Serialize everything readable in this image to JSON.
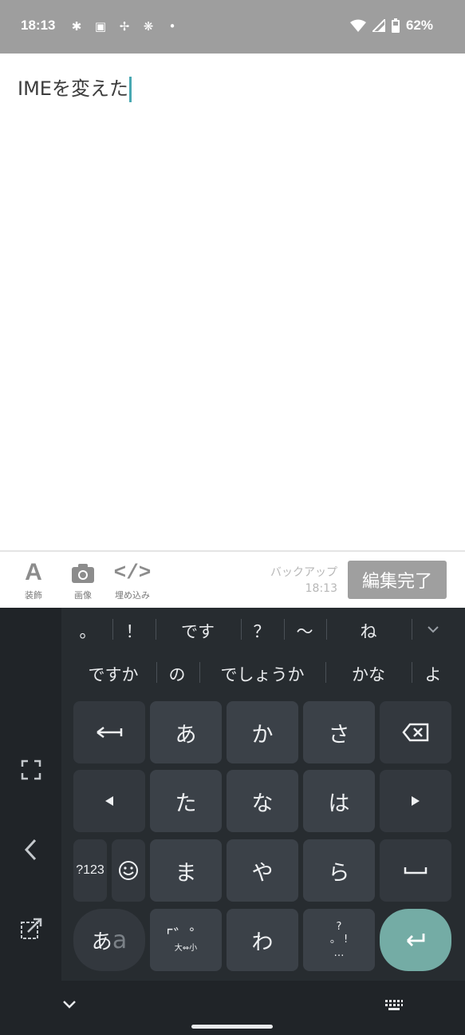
{
  "status_bar": {
    "time": "18:13",
    "battery": "62%",
    "icons_left": [
      "slack-icon",
      "book-icon",
      "pinwheel-icon",
      "chat-icon",
      "dot-icon"
    ],
    "icons_right": [
      "wifi-icon",
      "signal-icon",
      "battery-icon"
    ]
  },
  "editor": {
    "text": "IMEを変えた"
  },
  "toolbar": {
    "decoration_label": "装飾",
    "image_label": "画像",
    "embed_label": "埋め込み",
    "backup_label": "バックアップ",
    "backup_time": "18:13",
    "done_label": "編集完了"
  },
  "keyboard": {
    "candidates_row1": [
      "。",
      "！",
      "です",
      "？",
      "〜",
      "ね"
    ],
    "candidates_row2": [
      "ですか",
      "の",
      "でしょうか",
      "かな",
      "よ"
    ],
    "keys": {
      "a": "あ",
      "ka": "か",
      "sa": "さ",
      "ta": "た",
      "na": "な",
      "ha": "は",
      "ma": "ま",
      "ya": "や",
      "ra": "ら",
      "wa": "わ",
      "num": "?123",
      "mode_a": "あ",
      "mode_b": "a",
      "dakuten_sub": "大⇔小",
      "punct_top": "?",
      "punct_mid": "。 !",
      "punct_bottom": "…"
    }
  },
  "colors": {
    "status_bar": "#9e9e9e",
    "cursor": "#49a8b2",
    "keyboard_bg": "#272c30",
    "key_bg": "#3b4148",
    "enter_bg": "#74aca5",
    "done_btn": "#9f9f9f"
  }
}
